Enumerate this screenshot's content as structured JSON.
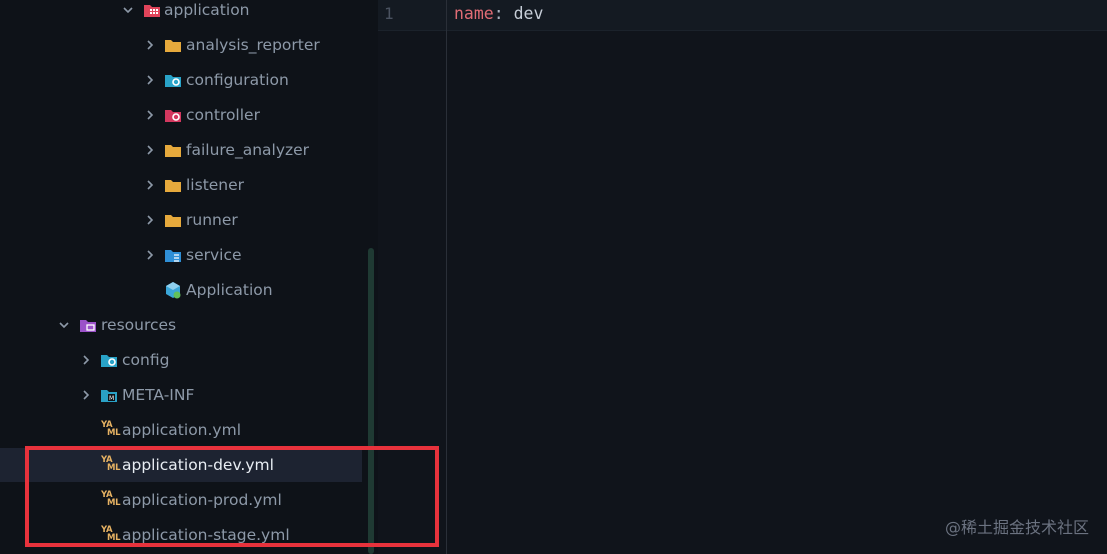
{
  "tree": {
    "items": [
      {
        "label": "application",
        "icon": "folder-package-icon",
        "chevron": "down",
        "selected": false
      },
      {
        "label": "analysis_reporter",
        "icon": "folder-icon",
        "chevron": "right",
        "selected": false
      },
      {
        "label": "configuration",
        "icon": "folder-config-icon",
        "chevron": "right",
        "selected": false
      },
      {
        "label": "controller",
        "icon": "folder-controller-icon",
        "chevron": "right",
        "selected": false
      },
      {
        "label": "failure_analyzer",
        "icon": "folder-icon",
        "chevron": "right",
        "selected": false
      },
      {
        "label": "listener",
        "icon": "folder-icon",
        "chevron": "right",
        "selected": false
      },
      {
        "label": "runner",
        "icon": "folder-icon",
        "chevron": "right",
        "selected": false
      },
      {
        "label": "service",
        "icon": "folder-service-icon",
        "chevron": "right",
        "selected": false
      },
      {
        "label": "Application",
        "icon": "spring-application-icon",
        "chevron": "none",
        "selected": false
      },
      {
        "label": "resources",
        "icon": "folder-resources-icon",
        "chevron": "down",
        "selected": false
      },
      {
        "label": "config",
        "icon": "folder-config-icon",
        "chevron": "right",
        "selected": false
      },
      {
        "label": "META-INF",
        "icon": "folder-meta-icon",
        "chevron": "right",
        "selected": false
      },
      {
        "label": "application.yml",
        "icon": "yaml-file-icon",
        "chevron": "none",
        "selected": false
      },
      {
        "label": "application-dev.yml",
        "icon": "yaml-file-icon",
        "chevron": "none",
        "selected": true
      },
      {
        "label": "application-prod.yml",
        "icon": "yaml-file-icon",
        "chevron": "none",
        "selected": false
      },
      {
        "label": "application-stage.yml",
        "icon": "yaml-file-icon",
        "chevron": "none",
        "selected": false
      }
    ]
  },
  "editor": {
    "line_number": "1",
    "key": "name",
    "separator": ":",
    "value": " dev"
  },
  "watermark": "@稀土掘金技术社区",
  "colors": {
    "folder": "#e6a93c",
    "config_folder": "#29a3c8",
    "controller_folder": "#d3385f",
    "package_folder": "#e0445a",
    "resources_folder": "#9b52c9",
    "highlight_box": "#e8323c",
    "yaml_key": "#e06c75"
  }
}
